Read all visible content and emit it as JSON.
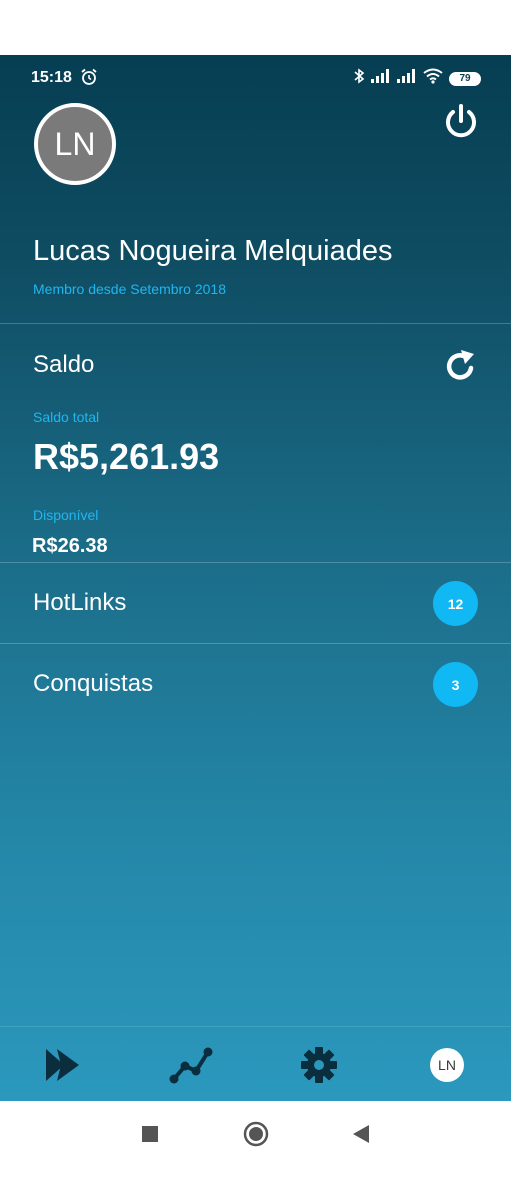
{
  "status_bar": {
    "time": "15:18",
    "battery": "79",
    "icons": [
      "alarm-icon",
      "bluetooth-icon",
      "signal-icon",
      "signal-icon",
      "wifi-icon",
      "battery-icon"
    ]
  },
  "profile": {
    "initials": "LN",
    "name": "Lucas Nogueira Melquiades",
    "member_since": "Membro desde Setembro 2018"
  },
  "balance": {
    "title": "Saldo",
    "total_label": "Saldo total",
    "total_value": "R$5,261.93",
    "available_label": "Disponível",
    "available_value": "R$26.38"
  },
  "menu": [
    {
      "label": "HotLinks",
      "count": "12"
    },
    {
      "label": "Conquistas",
      "count": "3"
    }
  ],
  "bottom_nav": {
    "items": [
      "play-icon",
      "chart-icon",
      "gear-icon",
      "profile-avatar"
    ],
    "avatar_initials": "LN"
  },
  "colors": {
    "accent": "#1fb6f0",
    "badge": "#10b8f4",
    "gradient_top": "#063e52",
    "gradient_bottom": "#2b98bd",
    "icon_dark": "#0a2e3d"
  },
  "system_nav": [
    "recents-button",
    "home-button",
    "back-button"
  ]
}
